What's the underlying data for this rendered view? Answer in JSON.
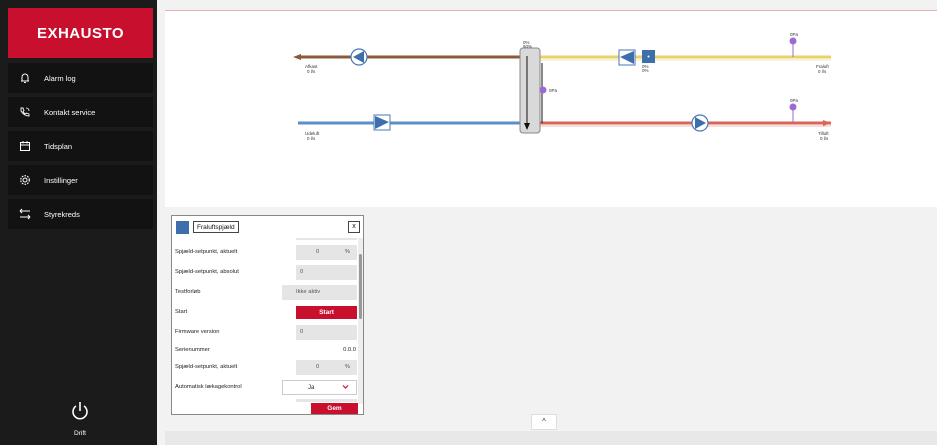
{
  "brand": {
    "logo_text": "EXHAUSTO",
    "brand_color": "#c8102e"
  },
  "sidebar": {
    "items": [
      {
        "label": "Alarm log",
        "icon": "bell-icon"
      },
      {
        "label": "Kontakt service",
        "icon": "phone-icon"
      },
      {
        "label": "Tidsplan",
        "icon": "calendar-icon"
      },
      {
        "label": "Instillinger",
        "icon": "gear-icon"
      },
      {
        "label": "Styrekreds",
        "icon": "arrows-icon"
      }
    ],
    "power": {
      "label": "Drift",
      "icon": "power-icon"
    }
  },
  "diagram": {
    "afkast": {
      "label": "Afkast",
      "value": "0 l/s"
    },
    "fraluft": {
      "label": "Fraluft",
      "value": "0 l/s"
    },
    "udeluft": {
      "label": "Udeluft",
      "value": "0 l/s"
    },
    "tilluft": {
      "label": "Tilluft",
      "value": "0 l/s"
    },
    "exchanger_top": "0%",
    "exchanger_pct": "50%",
    "damper_pct": "0%",
    "damper_pct2": "0%",
    "pressure1": "0Pa",
    "pressure2": "0Pa",
    "pressure3": "0Pa"
  },
  "popup": {
    "title": "Fraluftspjæld",
    "close": "x",
    "rows": [
      {
        "label": "Spjæld-setpunkt, aktuelt",
        "value": "0",
        "unit": "%"
      },
      {
        "label": "Spjæld-setpunkt, absolut",
        "value": "0"
      },
      {
        "label": "Testforløb",
        "value": "Ikke aktiv"
      },
      {
        "label": "Start",
        "button": "Start"
      },
      {
        "label": "Firmware version",
        "value": "0"
      },
      {
        "label": "Serienummer",
        "value": "0.0.0"
      },
      {
        "label": "Spjæld-setpunkt, aktuelt",
        "value": "0",
        "unit": "%"
      },
      {
        "label": "Automatisk lækagekontrol",
        "value": "Ja"
      }
    ],
    "save_label": "Gem"
  },
  "collapse_icon": "chevron-up-icon",
  "collapse_glyph": "^"
}
